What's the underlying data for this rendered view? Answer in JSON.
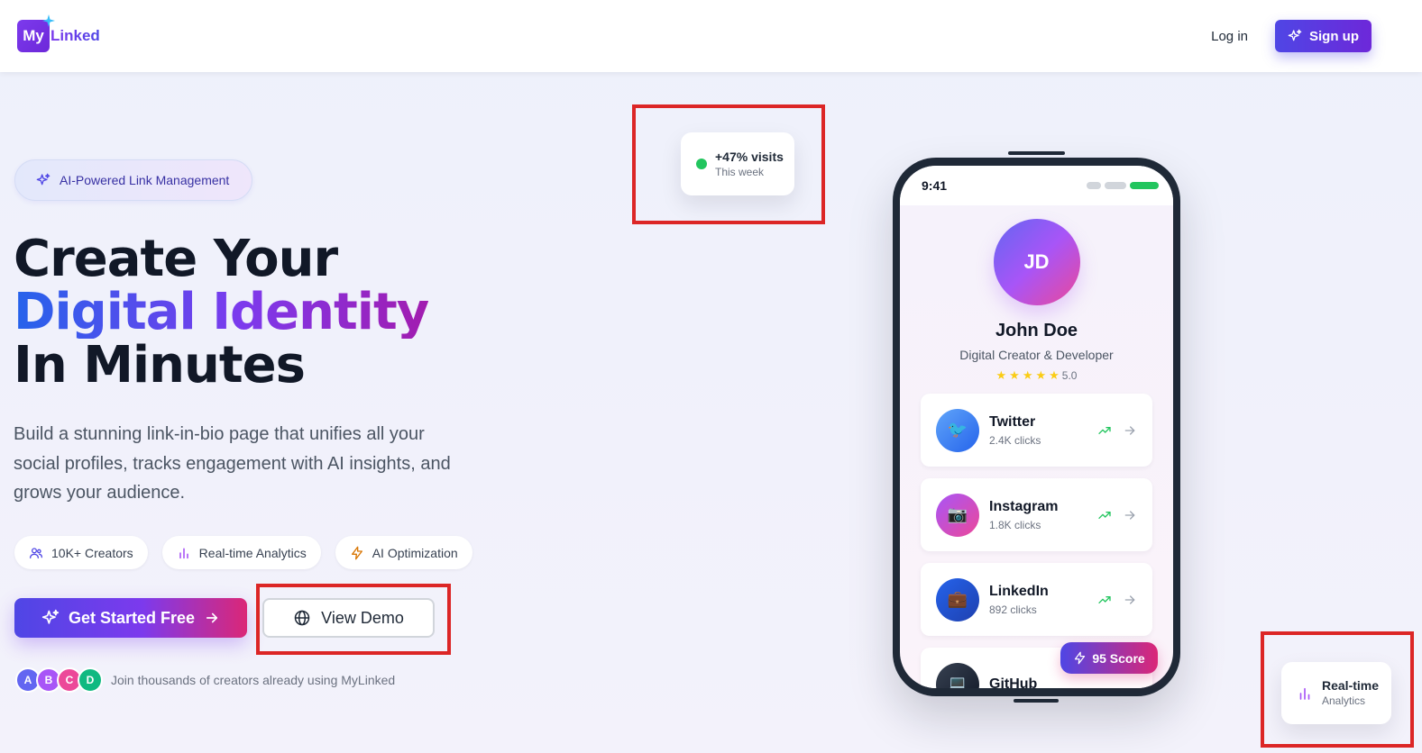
{
  "header": {
    "logo_box": "My",
    "logo_text": "Linked",
    "login_label": "Log in",
    "signup_label": "Sign up"
  },
  "hero": {
    "badge": "AI-Powered Link Management",
    "headline_line1": "Create Your",
    "headline_line2": "Digital Identity",
    "headline_line3": "In Minutes",
    "subtitle": "Build a stunning link-in-bio page that unifies all your social profiles, tracks engagement with AI insights, and grows your audience.",
    "chips": [
      {
        "label": "10K+ Creators",
        "icon": "users-icon"
      },
      {
        "label": "Real-time Analytics",
        "icon": "bar-chart-icon"
      },
      {
        "label": "AI Optimization",
        "icon": "lightning-icon"
      }
    ],
    "cta_primary": "Get Started Free",
    "cta_secondary": "View Demo",
    "avatars": [
      "A",
      "B",
      "C",
      "D"
    ],
    "proof_text": "Join thousands of creators already using MyLinked"
  },
  "floating": {
    "visits_title": "+47% visits",
    "visits_sub": "This week",
    "rt_title": "Real-time",
    "rt_sub": "Analytics"
  },
  "phone": {
    "time": "9:41",
    "initials": "JD",
    "name": "John Doe",
    "role": "Digital Creator & Developer",
    "rating": "5.0",
    "links": [
      {
        "name": "Twitter",
        "clicks": "2.4K clicks",
        "emoji": "🐦"
      },
      {
        "name": "Instagram",
        "clicks": "1.8K clicks",
        "emoji": "📷"
      },
      {
        "name": "LinkedIn",
        "clicks": "892 clicks",
        "emoji": "💼"
      },
      {
        "name": "GitHub",
        "clicks": "",
        "emoji": "💻"
      }
    ],
    "score": "95 Score"
  },
  "colors": {
    "accent": "#4f46e5",
    "purple": "#7c3aed",
    "pink": "#db2777",
    "green": "#22c55e",
    "highlight": "#dc2626"
  }
}
